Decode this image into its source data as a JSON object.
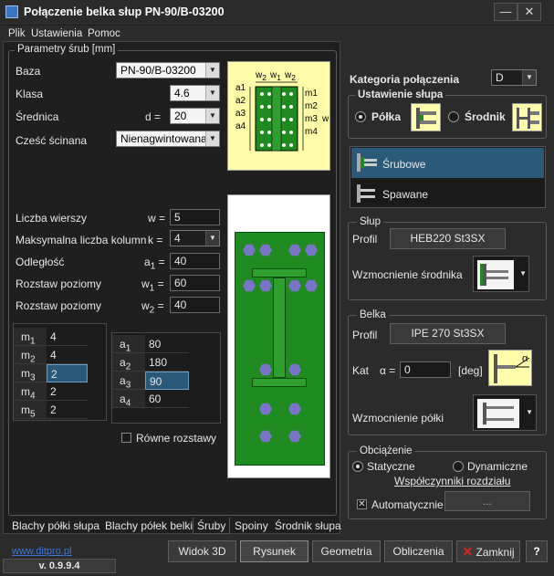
{
  "window": {
    "title": "Połączenie belka słup  PN-90/B-03200"
  },
  "menu": [
    "Plik",
    "Ustawienia",
    "Pomoc"
  ],
  "bolt_params": {
    "group_label": "Parametry śrub [mm]",
    "baza_label": "Baza",
    "baza_value": "PN-90/B-03200",
    "klasa_label": "Klasa",
    "klasa_value": "4.6",
    "srednica_label": "Średnica",
    "srednica_sym": "d =",
    "srednica_value": "20",
    "czesc_label": "Cześć ścinana",
    "czesc_value": "Nienagwintowana",
    "liczba_wierszy_label": "Liczba wierszy",
    "w_sym": "w =",
    "w_value": "5",
    "max_kolumn_label": "Maksymalna liczba kolumn",
    "k_sym": "k =",
    "k_value": "4",
    "odleglosc_label": "Odległość",
    "a1_sym": "a",
    "a1_sub": "1",
    "a1_eq": " =",
    "a1_value": "40",
    "rozstaw1_label": "Rozstaw poziomy",
    "w1_sym": "w",
    "w1_sub": "1",
    "w1_eq": " =",
    "w1_value": "60",
    "rozstaw2_label": "Rozstaw poziomy",
    "w2_sym": "w",
    "w2_sub": "2",
    "w2_eq": " =",
    "w2_value": "40",
    "m_rows": [
      {
        "sym": "m",
        "sub": "1",
        "value": "4"
      },
      {
        "sym": "m",
        "sub": "2",
        "value": "4"
      },
      {
        "sym": "m",
        "sub": "3",
        "value": "2"
      },
      {
        "sym": "m",
        "sub": "4",
        "value": "2"
      },
      {
        "sym": "m",
        "sub": "5",
        "value": "2"
      }
    ],
    "a_rows": [
      {
        "sym": "a",
        "sub": "1",
        "value": "80"
      },
      {
        "sym": "a",
        "sub": "2",
        "value": "180"
      },
      {
        "sym": "a",
        "sub": "3",
        "value": "90"
      },
      {
        "sym": "a",
        "sub": "4",
        "value": "60"
      }
    ],
    "rowne_label": "Równe rozstawy",
    "diagram": {
      "top_labels": [
        "w",
        "2",
        "w",
        "1",
        "w",
        "2"
      ],
      "left_labels": [
        "a1",
        "a2",
        "a3",
        "a4"
      ],
      "right_labels": [
        "m1",
        "m2",
        "m3",
        "m4"
      ],
      "w_label": "w"
    }
  },
  "tabs": [
    "Blachy półki słupa",
    "Blachy półek belki",
    "Śruby",
    "Spoiny",
    "Środnik słupa"
  ],
  "link": "www.ditpro.pl",
  "version": "v. 0.9.9.4",
  "buttons": {
    "widok3d": "Widok 3D",
    "rysunek": "Rysunek",
    "geometria": "Geometria",
    "obliczenia": "Obliczenia",
    "zamknij": "Zamknij",
    "help": "?"
  },
  "kategoria": {
    "label": "Kategoria połączenia",
    "value": "D"
  },
  "ustawienie": {
    "label": "Ustawienie słupa",
    "polka": "Półka",
    "srodnik": "Środnik"
  },
  "connection_types": [
    "Śrubowe",
    "Spawane"
  ],
  "slup": {
    "label": "Słup",
    "profil_label": "Profil",
    "profil_value": "HEB220 St3SX",
    "wzm_label": "Wzmocnienie środnika"
  },
  "belka": {
    "label": "Belka",
    "profil_label": "Profil",
    "profil_value": "IPE 270 St3SX",
    "kat_label": "Kat",
    "alpha_sym": "α =",
    "kat_value": "0",
    "kat_unit": "[deg]",
    "wzm_label": "Wzmocnienie półki",
    "alpha_icon": "α"
  },
  "obciazenie": {
    "label": "Obciążenie",
    "statyczne": "Statyczne",
    "dynamiczne": "Dynamiczne",
    "wspolczynniki": "Współczynniki rozdziału",
    "automatycznie": "Automatycznie",
    "dots": "..."
  },
  "colors": {
    "accent": "#2a5a78",
    "plate_green": "#1f8a1f",
    "bolt": "#7a74c9",
    "diagram_bg": "#fffcaa"
  }
}
